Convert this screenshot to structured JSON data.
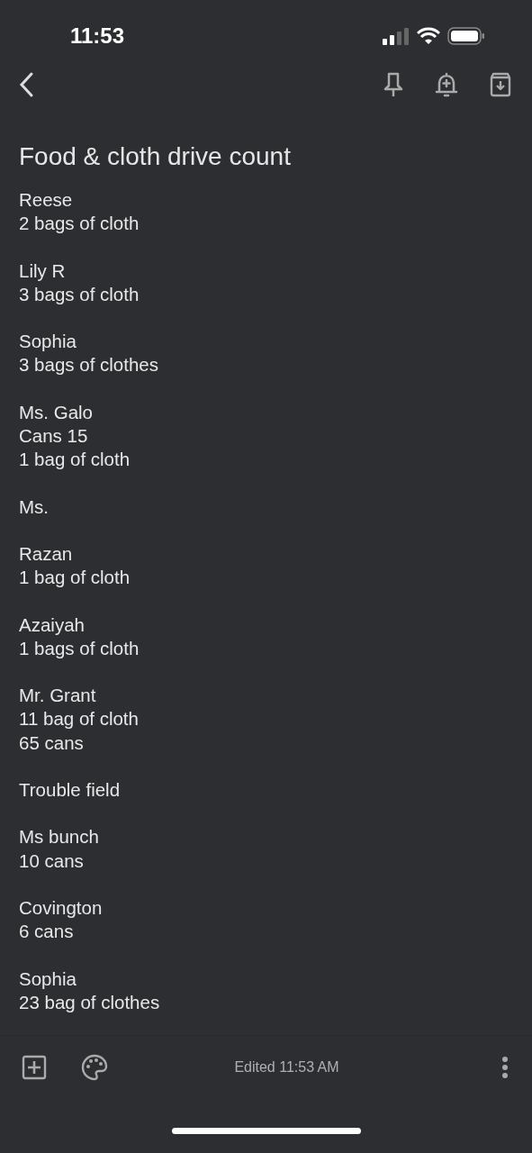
{
  "status_bar": {
    "time": "11:53"
  },
  "note": {
    "title": "Food & cloth drive count",
    "blocks": [
      [
        "Reese",
        "2 bags of cloth"
      ],
      [
        "Lily R",
        "3 bags of cloth"
      ],
      [
        "Sophia",
        "3 bags of clothes"
      ],
      [
        "Ms. Galo",
        "Cans 15",
        "1 bag of cloth"
      ],
      [
        "Ms."
      ],
      [
        "Razan",
        "1 bag of cloth"
      ],
      [
        "Azaiyah",
        "1 bags of cloth"
      ],
      [
        "Mr. Grant",
        "11 bag of cloth",
        "65 cans"
      ],
      [
        "Trouble field"
      ],
      [
        "Ms bunch",
        "10 cans"
      ],
      [
        "Covington",
        "6 cans"
      ],
      [
        "Sophia",
        "23 bag of clothes"
      ]
    ]
  },
  "footer": {
    "edited": "Edited 11:53 AM"
  }
}
